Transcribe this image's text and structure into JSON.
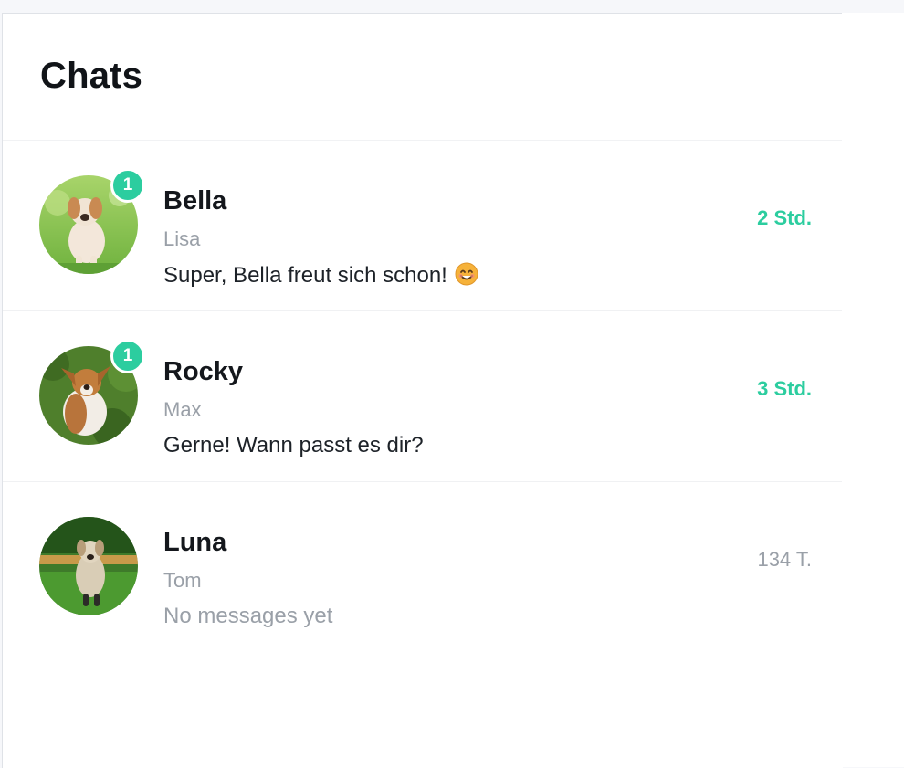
{
  "header": {
    "title": "Chats"
  },
  "colors": {
    "accent": "#2ccd9f",
    "muted": "#9aa0a8",
    "text": "#14171c"
  },
  "chats": [
    {
      "name": "Bella",
      "owner": "Lisa",
      "last_message": "Super, Bella freut sich schon!",
      "emoji": "smiling-face-icon",
      "time": "2 Std.",
      "unread": "1",
      "avatar": "dog-avatar-bella"
    },
    {
      "name": "Rocky",
      "owner": "Max",
      "last_message": "Gerne! Wann passt es dir?",
      "time": "3 Std.",
      "unread": "1",
      "avatar": "dog-avatar-rocky"
    },
    {
      "name": "Luna",
      "owner": "Tom",
      "last_message": "No messages yet",
      "time": "134 T.",
      "avatar": "dog-avatar-luna"
    }
  ]
}
